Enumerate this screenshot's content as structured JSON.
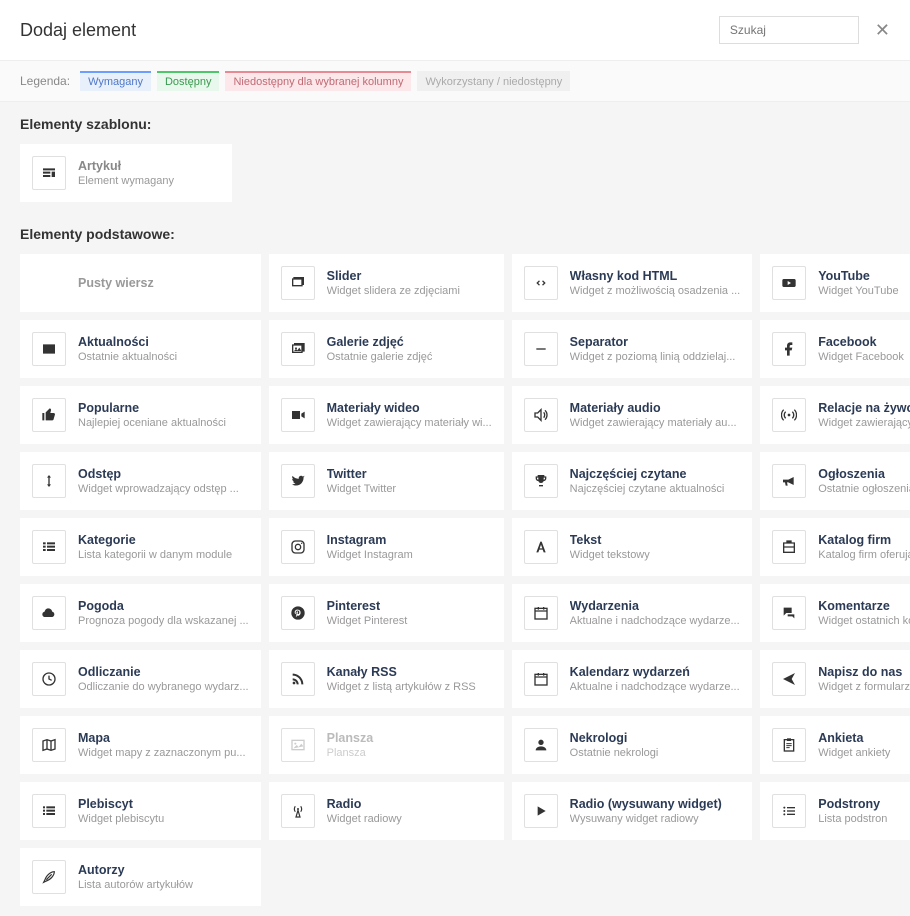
{
  "header": {
    "title": "Dodaj element"
  },
  "search": {
    "placeholder": "Szukaj"
  },
  "legend": {
    "label": "Legenda:",
    "required": "Wymagany",
    "available": "Dostępny",
    "unavailable": "Niedostępny dla wybranej kolumny",
    "used": "Wykorzystany / niedostępny"
  },
  "sections": {
    "template_title": "Elementy szablonu:",
    "basic_title": "Elementy podstawowe:"
  },
  "template": {
    "artykul": {
      "title": "Artykuł",
      "sub": "Element wymagany"
    }
  },
  "els": {
    "pusty": {
      "title": "Pusty wiersz",
      "sub": ""
    },
    "slider": {
      "title": "Slider",
      "sub": "Widget slidera ze zdjęciami"
    },
    "html": {
      "title": "Własny kod HTML",
      "sub": "Widget z możliwością osadzenia ..."
    },
    "youtube": {
      "title": "YouTube",
      "sub": "Widget YouTube"
    },
    "aktualnosci": {
      "title": "Aktualności",
      "sub": "Ostatnie aktualności"
    },
    "galerie": {
      "title": "Galerie zdjęć",
      "sub": "Ostatnie galerie zdjęć"
    },
    "separator": {
      "title": "Separator",
      "sub": "Widget z poziomą linią oddzielaj..."
    },
    "facebook": {
      "title": "Facebook",
      "sub": "Widget Facebook"
    },
    "popularne": {
      "title": "Popularne",
      "sub": "Najlepiej oceniane aktualności"
    },
    "wideo": {
      "title": "Materiały wideo",
      "sub": "Widget zawierający materiały wi..."
    },
    "audio": {
      "title": "Materiały audio",
      "sub": "Widget zawierający materiały au..."
    },
    "relacje": {
      "title": "Relacje na żywo",
      "sub": "Widget zawierający relacje na ży..."
    },
    "odstep": {
      "title": "Odstęp",
      "sub": "Widget wprowadzający odstęp ..."
    },
    "twitter": {
      "title": "Twitter",
      "sub": "Widget Twitter"
    },
    "czytane": {
      "title": "Najczęściej czytane",
      "sub": "Najczęściej czytane aktualności"
    },
    "ogloszenia": {
      "title": "Ogłoszenia",
      "sub": "Ostatnie ogłoszenia"
    },
    "kategorie": {
      "title": "Kategorie",
      "sub": "Lista kategorii w danym module"
    },
    "instagram": {
      "title": "Instagram",
      "sub": "Widget Instagram"
    },
    "tekst": {
      "title": "Tekst",
      "sub": "Widget tekstowy"
    },
    "katalog": {
      "title": "Katalog firm",
      "sub": "Katalog firm oferujących swoje u..."
    },
    "pogoda": {
      "title": "Pogoda",
      "sub": "Prognoza pogody dla wskazanej ..."
    },
    "pinterest": {
      "title": "Pinterest",
      "sub": "Widget Pinterest"
    },
    "wydarzenia": {
      "title": "Wydarzenia",
      "sub": "Aktualne i nadchodzące wydarze..."
    },
    "komentarze": {
      "title": "Komentarze",
      "sub": "Widget ostatnich komentarzy w ..."
    },
    "odliczanie": {
      "title": "Odliczanie",
      "sub": "Odliczanie do wybranego wydarz..."
    },
    "rss": {
      "title": "Kanały RSS",
      "sub": "Widget z listą artykułów z RSS"
    },
    "kalendarz": {
      "title": "Kalendarz wydarzeń",
      "sub": "Aktualne i nadchodzące wydarze..."
    },
    "napisz": {
      "title": "Napisz do nas",
      "sub": "Widget z formularzem kontakto..."
    },
    "mapa": {
      "title": "Mapa",
      "sub": "Widget mapy z zaznaczonym pu..."
    },
    "plansza": {
      "title": "Plansza",
      "sub": "Plansza"
    },
    "nekrologi": {
      "title": "Nekrologi",
      "sub": "Ostatnie nekrologi"
    },
    "ankieta": {
      "title": "Ankieta",
      "sub": "Widget ankiety"
    },
    "plebiscyt": {
      "title": "Plebiscyt",
      "sub": "Widget plebiscytu"
    },
    "radio": {
      "title": "Radio",
      "sub": "Widget radiowy"
    },
    "radioslide": {
      "title": "Radio (wysuwany widget)",
      "sub": "Wysuwany widget radiowy"
    },
    "podstrony": {
      "title": "Podstrony",
      "sub": "Lista podstron"
    },
    "autorzy": {
      "title": "Autorzy",
      "sub": "Lista autorów artykułów"
    }
  }
}
